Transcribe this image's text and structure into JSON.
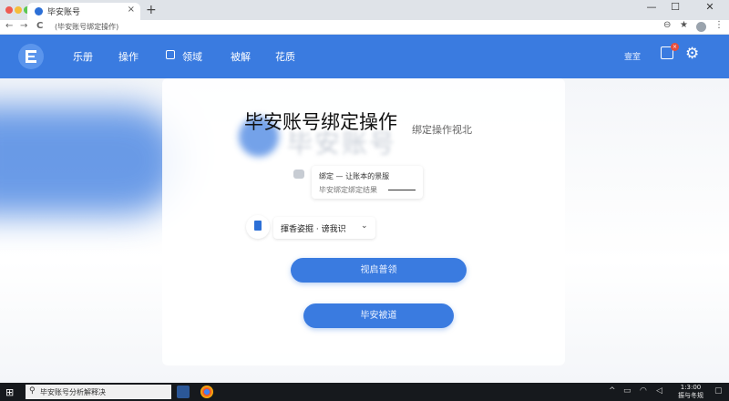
{
  "browser": {
    "tab_title": "毕安账号",
    "tab_close": "×",
    "new_tab": "+",
    "url": "(毕安账号绑定操作)",
    "win_min": "—",
    "win_max": "☐",
    "win_close": "✕",
    "back": "←",
    "forward": "→",
    "reload": "C",
    "zoom_icon": "⊖",
    "star_icon": "★",
    "menu_icon": "⋮"
  },
  "header": {
    "menu": [
      "乐册",
      "操作",
      "领域",
      "被解",
      "花质"
    ],
    "right_text": "壹室",
    "badge": "×",
    "gear": "⚙"
  },
  "main": {
    "title": "毕安账号绑定操作",
    "ghost_title": "毕安账号",
    "subtitle": "绑定操作视北",
    "note_line1": "绑定 — 让账本的景服",
    "note_line2": "毕安绑定绑定结果",
    "selector_text": "揮香姿掘 · 谤我识",
    "selector_chev": "⌄",
    "btn1": "视启普领",
    "btn2": "毕安被道"
  },
  "taskbar": {
    "start": "⊞",
    "search_icon": "⚲",
    "search_text": "毕安账号分析解释决",
    "tray_up": "^",
    "time": "1:3:00",
    "date": "振与冬规"
  },
  "colors": {
    "brand_blue": "#3a7be0",
    "badge_red": "#e74c3c",
    "taskbar": "#16191d"
  }
}
